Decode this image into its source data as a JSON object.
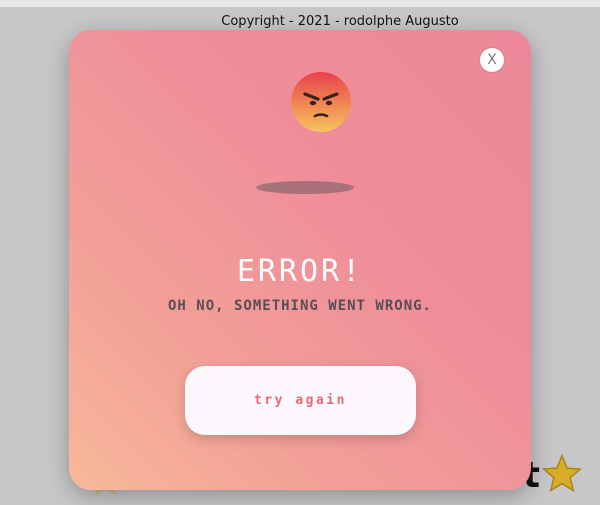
{
  "page": {
    "copyright": "Copyright - 2021 - rodolphe Augusto",
    "background_heading_fragment": "t"
  },
  "modal": {
    "close_label": "X",
    "title": "ERROR!",
    "message": "OH NO, SOMETHING WENT WRONG.",
    "button_label": "try again",
    "face_icon": "angry-face-icon",
    "colors": {
      "gradient_start": "#f8b89a",
      "gradient_end": "#ec8899",
      "button_text": "#e86a78",
      "title_text": "#ffffff",
      "message_text": "#5a4e55"
    }
  },
  "icons": {
    "star": "star-icon"
  }
}
